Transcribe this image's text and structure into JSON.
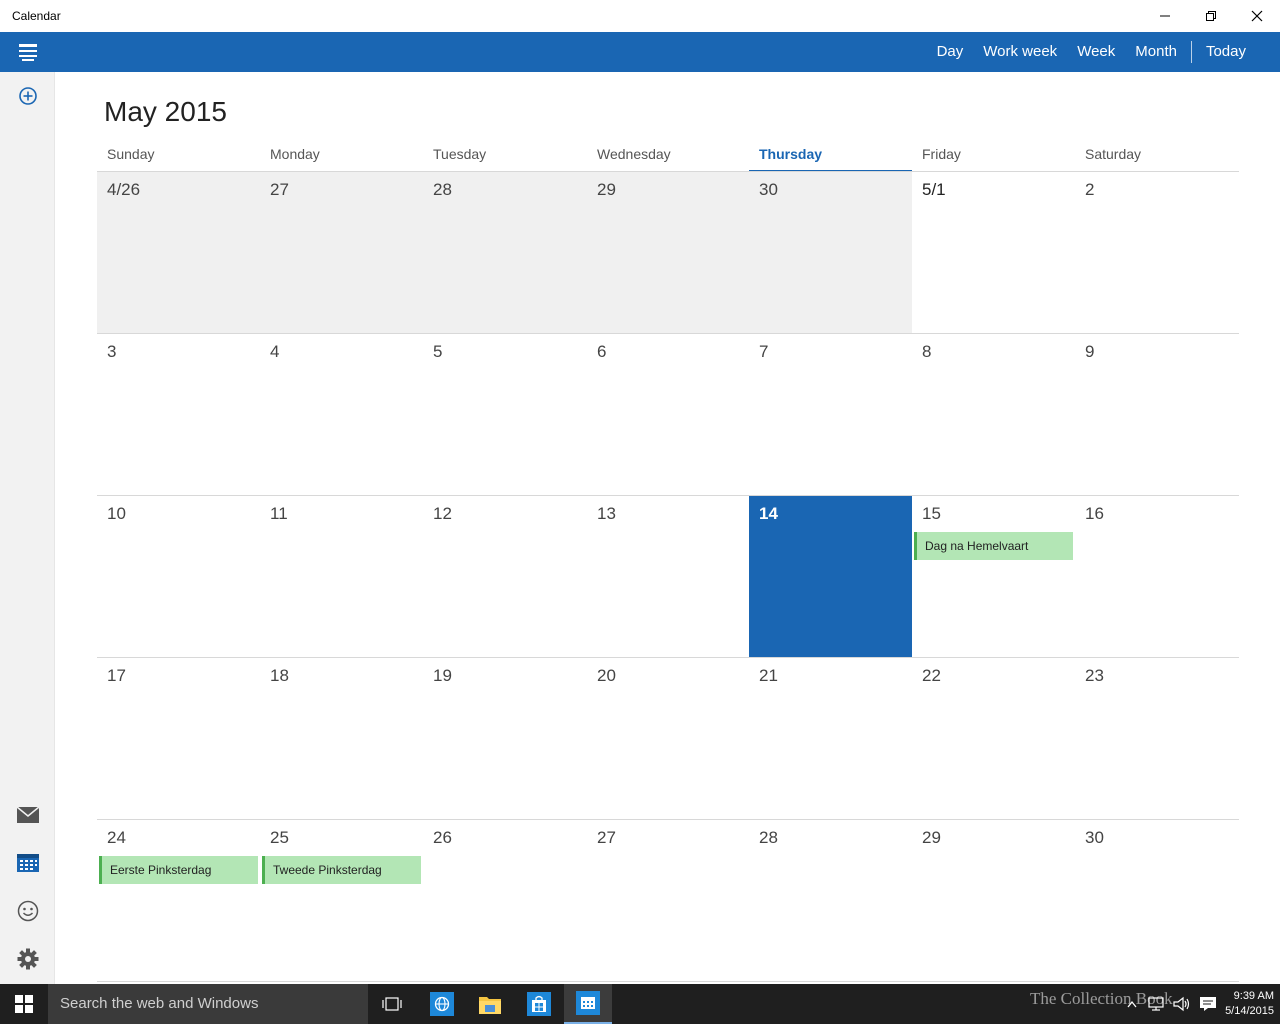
{
  "window": {
    "title": "Calendar"
  },
  "header": {
    "views": [
      "Day",
      "Work week",
      "Week",
      "Month"
    ],
    "today_label": "Today"
  },
  "calendar": {
    "month_title": "May 2015",
    "weekdays": [
      "Sunday",
      "Monday",
      "Tuesday",
      "Wednesday",
      "Thursday",
      "Friday",
      "Saturday"
    ],
    "today_weekday_index": 4,
    "weeks": [
      [
        "4/26",
        "27",
        "28",
        "29",
        "30",
        "5/1",
        "2"
      ],
      [
        "3",
        "4",
        "5",
        "6",
        "7",
        "8",
        "9"
      ],
      [
        "10",
        "11",
        "12",
        "13",
        "14",
        "15",
        "16"
      ],
      [
        "17",
        "18",
        "19",
        "20",
        "21",
        "22",
        "23"
      ],
      [
        "24",
        "25",
        "26",
        "27",
        "28",
        "29",
        "30"
      ]
    ],
    "today_date": "14",
    "events": [
      {
        "label": "Dag na Hemelvaart",
        "date": "15"
      },
      {
        "label": "Eerste Pinksterdag",
        "date": "24"
      },
      {
        "label": "Tweede Pinksterdag",
        "date": "25"
      }
    ],
    "event_color": "#b3e6b5",
    "accent_color": "#1a66b3"
  },
  "sidebar": {
    "icons": [
      "menu-icon",
      "new-event-icon",
      "mail-icon",
      "calendar-icon",
      "feedback-icon",
      "settings-icon"
    ]
  },
  "taskbar": {
    "search_placeholder": "Search the web and Windows",
    "clock_time": "9:39 AM",
    "clock_date": "5/14/2015",
    "watermark": "The Collection Book"
  }
}
